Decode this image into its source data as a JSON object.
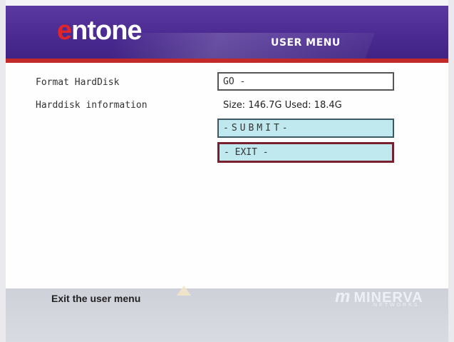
{
  "header": {
    "logo_first_letter": "e",
    "logo_rest": "ntone",
    "menu_title": "USER MENU"
  },
  "menu": {
    "format_label": "Format HardDisk",
    "format_value": "GO -",
    "info_label": "Harddisk information",
    "info_value": "Size: 146.7G Used: 18.4G",
    "submit_label": "-SUBMIT-",
    "exit_label": "- EXIT -"
  },
  "footer": {
    "help_text": "Exit the user menu",
    "brand_mark": "m",
    "brand_name": "MINERVA",
    "brand_sub": "NETWORKS"
  },
  "colors": {
    "header_purple": "#4a2a90",
    "accent_red": "#c22a2a",
    "button_fill": "#bfe9ee",
    "focus_border": "#7a1f2e"
  }
}
